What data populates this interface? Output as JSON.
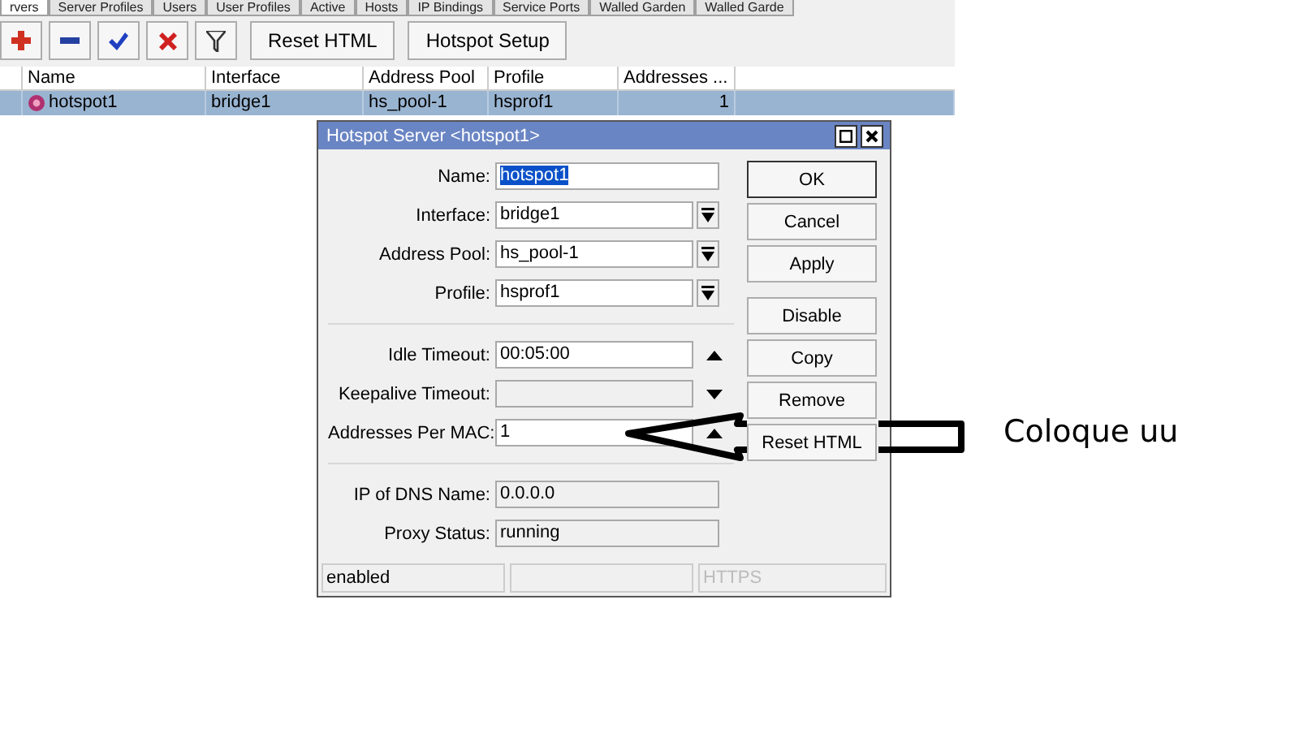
{
  "tabs": [
    {
      "label": "rvers",
      "selected": true
    },
    {
      "label": "Server Profiles",
      "selected": false
    },
    {
      "label": "Users",
      "selected": false
    },
    {
      "label": "User Profiles",
      "selected": false
    },
    {
      "label": "Active",
      "selected": false
    },
    {
      "label": "Hosts",
      "selected": false
    },
    {
      "label": "IP Bindings",
      "selected": false
    },
    {
      "label": "Service Ports",
      "selected": false
    },
    {
      "label": "Walled Garden",
      "selected": false
    },
    {
      "label": "Walled Garde",
      "selected": false
    }
  ],
  "toolbar": [
    {
      "kind": "add"
    },
    {
      "kind": "remove"
    },
    {
      "kind": "enable"
    },
    {
      "kind": "disable"
    },
    {
      "kind": "filter"
    },
    {
      "kind": "text",
      "label": "Reset HTML"
    },
    {
      "kind": "text",
      "label": "Hotspot Setup"
    }
  ],
  "table": {
    "columns": [
      "Name",
      "Interface",
      "Address Pool",
      "Profile",
      "Addresses ..."
    ],
    "rows": [
      {
        "selected": true,
        "cells": [
          "hotspot1",
          "bridge1",
          "hs_pool-1",
          "hsprof1",
          "1"
        ]
      }
    ]
  },
  "dialog": {
    "title": "Hotspot Server <hotspot1>",
    "field_groups": [
      [
        {
          "label": "Name:",
          "value": "hotspot1",
          "kind": "text",
          "highlighted": true
        },
        {
          "label": "Interface:",
          "value": "bridge1",
          "kind": "dropdown"
        },
        {
          "label": "Address Pool:",
          "value": "hs_pool-1",
          "kind": "dropdown"
        },
        {
          "label": "Profile:",
          "value": "hsprof1",
          "kind": "dropdown"
        }
      ],
      [
        {
          "label": "Idle Timeout:",
          "value": "00:05:00",
          "kind": "spin-up"
        },
        {
          "label": "Keepalive Timeout:",
          "kind": "spin-down",
          "disabled": true
        },
        {
          "label": "Addresses Per MAC:",
          "value": "1",
          "kind": "spin-up"
        }
      ],
      [
        {
          "label": "IP of DNS Name:",
          "value": "0.0.0.0",
          "kind": "readonly"
        },
        {
          "label": "Proxy Status:",
          "value": "running",
          "kind": "readonly"
        }
      ]
    ],
    "buttons": [
      {
        "label": "OK",
        "default": true
      },
      {
        "label": "Cancel",
        "default": false
      },
      {
        "label": "Apply",
        "default": false
      },
      {
        "label": "Disable",
        "default": false
      },
      {
        "label": "Copy",
        "default": false
      },
      {
        "label": "Remove",
        "default": false
      },
      {
        "label": "Reset HTML",
        "default": false
      }
    ],
    "status_bar": [
      {
        "text": "enabled",
        "disabled": false
      },
      {
        "text": "HTTPS",
        "disabled": true
      }
    ]
  },
  "annotation": {
    "text": "Coloque uu"
  }
}
